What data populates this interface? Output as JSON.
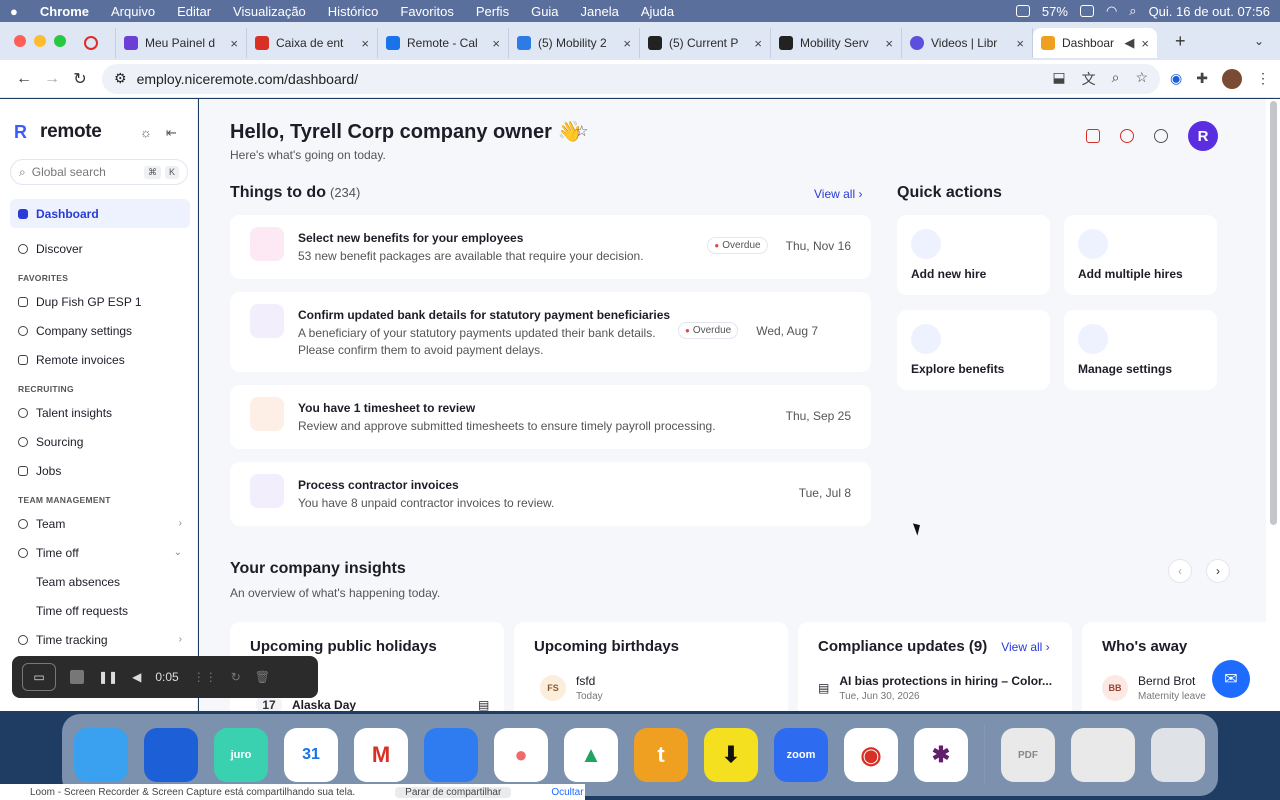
{
  "menubar": {
    "app": "Chrome",
    "items": [
      "Arquivo",
      "Editar",
      "Visualização",
      "Histórico",
      "Favoritos",
      "Perfis",
      "Guia",
      "Janela",
      "Ajuda"
    ],
    "battery": "57%",
    "datetime": "Qui. 16 de out.  07:56"
  },
  "tabs": [
    {
      "label": "",
      "color": "#d93025"
    },
    {
      "label": "Meu Painel d",
      "color": "#6b3fd6"
    },
    {
      "label": "Caixa de ent",
      "color": "#d93025"
    },
    {
      "label": "Remote - Cal",
      "color": "#1a73e8"
    },
    {
      "label": "(5) Mobility 2",
      "color": "#2d7be5"
    },
    {
      "label": "(5) Current P",
      "color": "#222222"
    },
    {
      "label": "Mobility Serv",
      "color": "#222222"
    },
    {
      "label": "Videos | Libr",
      "color": "#5b4fe0"
    },
    {
      "label": "Dashboar",
      "color": "#f0a020"
    }
  ],
  "address": {
    "url": "employ.niceremote.com/dashboard/"
  },
  "sidebar": {
    "brand": "remote",
    "search_placeholder": "Global search",
    "shortcut": [
      "⌘",
      "K"
    ],
    "items": [
      {
        "label": "Dashboard"
      },
      {
        "label": "Discover"
      }
    ],
    "sections": [
      {
        "title": "FAVORITES",
        "items": [
          "Dup Fish GP ESP 1",
          "Company settings",
          "Remote invoices"
        ]
      },
      {
        "title": "RECRUITING",
        "items": [
          "Talent insights",
          "Sourcing",
          "Jobs"
        ]
      },
      {
        "title": "TEAM MANAGEMENT",
        "items": [
          "Team",
          "Time off",
          "Team absences",
          "Time off requests",
          "Time tracking"
        ]
      }
    ]
  },
  "main": {
    "greeting": "Hello, Tyrell Corp company owner 👋",
    "greeting_sub": "Here's what's going on today.",
    "user_initial": "R",
    "todo_title": "Things to do",
    "todo_count": "(234)",
    "view_all": "View all",
    "todos": [
      {
        "title": "Select new benefits for your employees",
        "desc": "53 new benefit packages are available that require your decision.",
        "badge": "Overdue",
        "date": "Thu, Nov 16"
      },
      {
        "title": "Confirm updated bank details for statutory payment beneficiaries",
        "desc": "A beneficiary of your statutory payments updated their bank details. Please confirm them to avoid payment delays.",
        "badge": "Overdue",
        "date": "Wed, Aug 7"
      },
      {
        "title": "You have 1 timesheet to review",
        "desc": "Review and approve submitted timesheets to ensure timely payroll processing.",
        "badge": "",
        "date": "Thu, Sep 25"
      },
      {
        "title": "Process contractor invoices",
        "desc": "You have 8 unpaid contractor invoices to review.",
        "badge": "",
        "date": "Tue, Jul 8"
      }
    ],
    "quick_title": "Quick actions",
    "quick_actions": [
      "Add new hire",
      "Add multiple hires",
      "Explore benefits",
      "Manage settings"
    ],
    "insights_title": "Your company insights",
    "insights_sub": "An overview of what's happening today.",
    "cards": [
      {
        "title": "Upcoming public holidays",
        "item": "Alaska Day",
        "day": "17",
        "sub": ""
      },
      {
        "title": "Upcoming birthdays",
        "item": "fsfd",
        "avatar": "FS",
        "sub": "Today"
      },
      {
        "title": "Compliance updates (9)",
        "item": "AI bias protections in hiring – Color...",
        "sub": "Tue, Jun 30, 2026",
        "link": "View all"
      },
      {
        "title": "Who's away",
        "item": "Bernd Brot",
        "avatar": "BB",
        "sub": "Maternity leave"
      }
    ]
  },
  "recorder": {
    "time": "0:05"
  },
  "notice": {
    "text": "Loom - Screen Recorder & Screen Capture está compartilhando sua tela.",
    "button": "Parar de compartilhar",
    "link": "Ocultar"
  },
  "dock": [
    {
      "name": "Finder",
      "color": "#3aa0f0"
    },
    {
      "name": "1Password",
      "color": "#1d5fd6"
    },
    {
      "name": "juro",
      "color": "#3ad1b0"
    },
    {
      "name": "31",
      "color": "#ffffff"
    },
    {
      "name": "Gmail",
      "color": "#ffffff"
    },
    {
      "name": "Keynote",
      "color": "#2f7bf0"
    },
    {
      "name": "Asana",
      "color": "#ffffff"
    },
    {
      "name": "Drive",
      "color": "#ffffff"
    },
    {
      "name": "Toggl",
      "color": "#f0a020"
    },
    {
      "name": "Download",
      "color": "#f5e020"
    },
    {
      "name": "zoom",
      "color": "#2d6cf0"
    },
    {
      "name": "Chrome",
      "color": "#ffffff"
    },
    {
      "name": "Slack",
      "color": "#ffffff"
    },
    {
      "name": "PDF",
      "color": "#e9e9ea"
    },
    {
      "name": "Preview",
      "color": "#e9e9ea"
    },
    {
      "name": "Trash",
      "color": "#dfe3e8"
    }
  ]
}
